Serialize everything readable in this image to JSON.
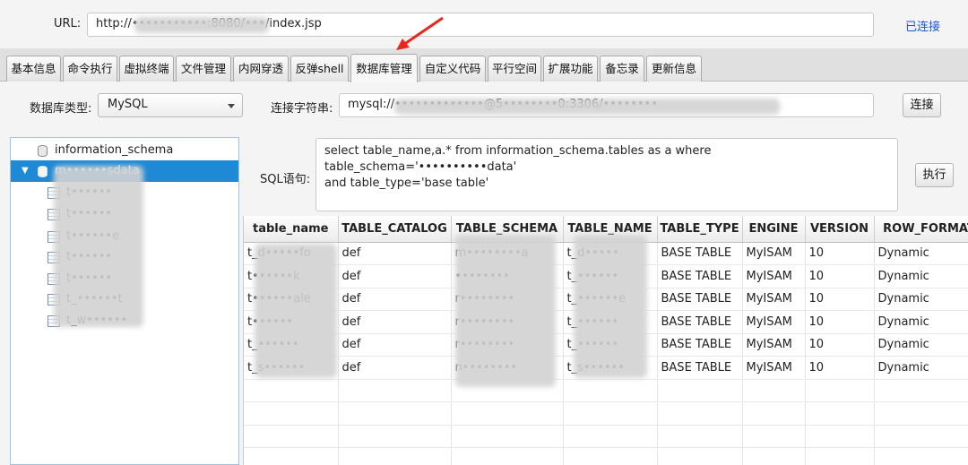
{
  "url_bar": {
    "label": "URL:",
    "value": "http://•••••••••••:8080/•••/index.jsp",
    "status": "已连接"
  },
  "tabs": [
    {
      "label": "基本信息",
      "active": false
    },
    {
      "label": "命令执行",
      "active": false
    },
    {
      "label": "虚拟终端",
      "active": false
    },
    {
      "label": "文件管理",
      "active": false
    },
    {
      "label": "内网穿透",
      "active": false
    },
    {
      "label": "反弹shell",
      "active": false
    },
    {
      "label": "数据库管理",
      "active": true
    },
    {
      "label": "自定义代码",
      "active": false
    },
    {
      "label": "平行空间",
      "active": false
    },
    {
      "label": "扩展功能",
      "active": false
    },
    {
      "label": "备忘录",
      "active": false
    },
    {
      "label": "更新信息",
      "active": false
    }
  ],
  "db_panel": {
    "type_label": "数据库类型:",
    "type_value": "MySQL",
    "conn_label": "连接字符串:",
    "conn_value": "mysql://•••••••••••••@5••••••••0:3306/••••••••",
    "connect_label": "连接"
  },
  "tree": {
    "databases": [
      {
        "name": "information_schema",
        "expanded": false,
        "selected": false
      },
      {
        "name": "m••••••sdata",
        "expanded": true,
        "selected": true
      }
    ],
    "tables": [
      "t••••••",
      "t••••••",
      "t••••••e",
      "t••••••",
      "t••••••",
      "t_••••••t",
      "t_w••••••"
    ]
  },
  "sql": {
    "label": "SQL语句:",
    "line1": "select table_name,a.* from information_schema.tables as a where table_schema='••••••••••data'",
    "line2": "and table_type='base table'",
    "execute_label": "执行"
  },
  "grid": {
    "columns": [
      "table_name",
      "TABLE_CATALOG",
      "TABLE_SCHEMA",
      "TABLE_NAME",
      "TABLE_TYPE",
      "ENGINE",
      "VERSION",
      "ROW_FORMAT"
    ],
    "rows": [
      [
        "t_d•••••fo",
        "def",
        "m••••••••a",
        "t_d•••••",
        "BASE TABLE",
        "MyISAM",
        "10",
        "Dynamic"
      ],
      [
        "t••••••k",
        "def",
        "••••••••",
        "t_••••••",
        "BASE TABLE",
        "MyISAM",
        "10",
        "Dynamic"
      ],
      [
        "t••••••ale",
        "def",
        "r••••••••",
        "t_••••••e",
        "BASE TABLE",
        "MyISAM",
        "10",
        "Dynamic"
      ],
      [
        "t••••••",
        "def",
        "r••••••••",
        "t_••••••",
        "BASE TABLE",
        "MyISAM",
        "10",
        "Dynamic"
      ],
      [
        "t_••••••",
        "def",
        "r••••••••",
        "t_••••••",
        "BASE TABLE",
        "MyISAM",
        "10",
        "Dynamic"
      ],
      [
        "t_s••••••",
        "def",
        "n••••••••",
        "t_s••••••",
        "BASE TABLE",
        "MyISAM",
        "10",
        "Dynamic"
      ],
      [
        "",
        "",
        "",
        "",
        "",
        "",
        "",
        ""
      ],
      [
        "",
        "",
        "",
        "",
        "",
        "",
        "",
        ""
      ],
      [
        "",
        "",
        "",
        "",
        "",
        "",
        "",
        ""
      ],
      [
        "",
        "",
        "",
        "",
        "",
        "",
        "",
        ""
      ]
    ]
  }
}
